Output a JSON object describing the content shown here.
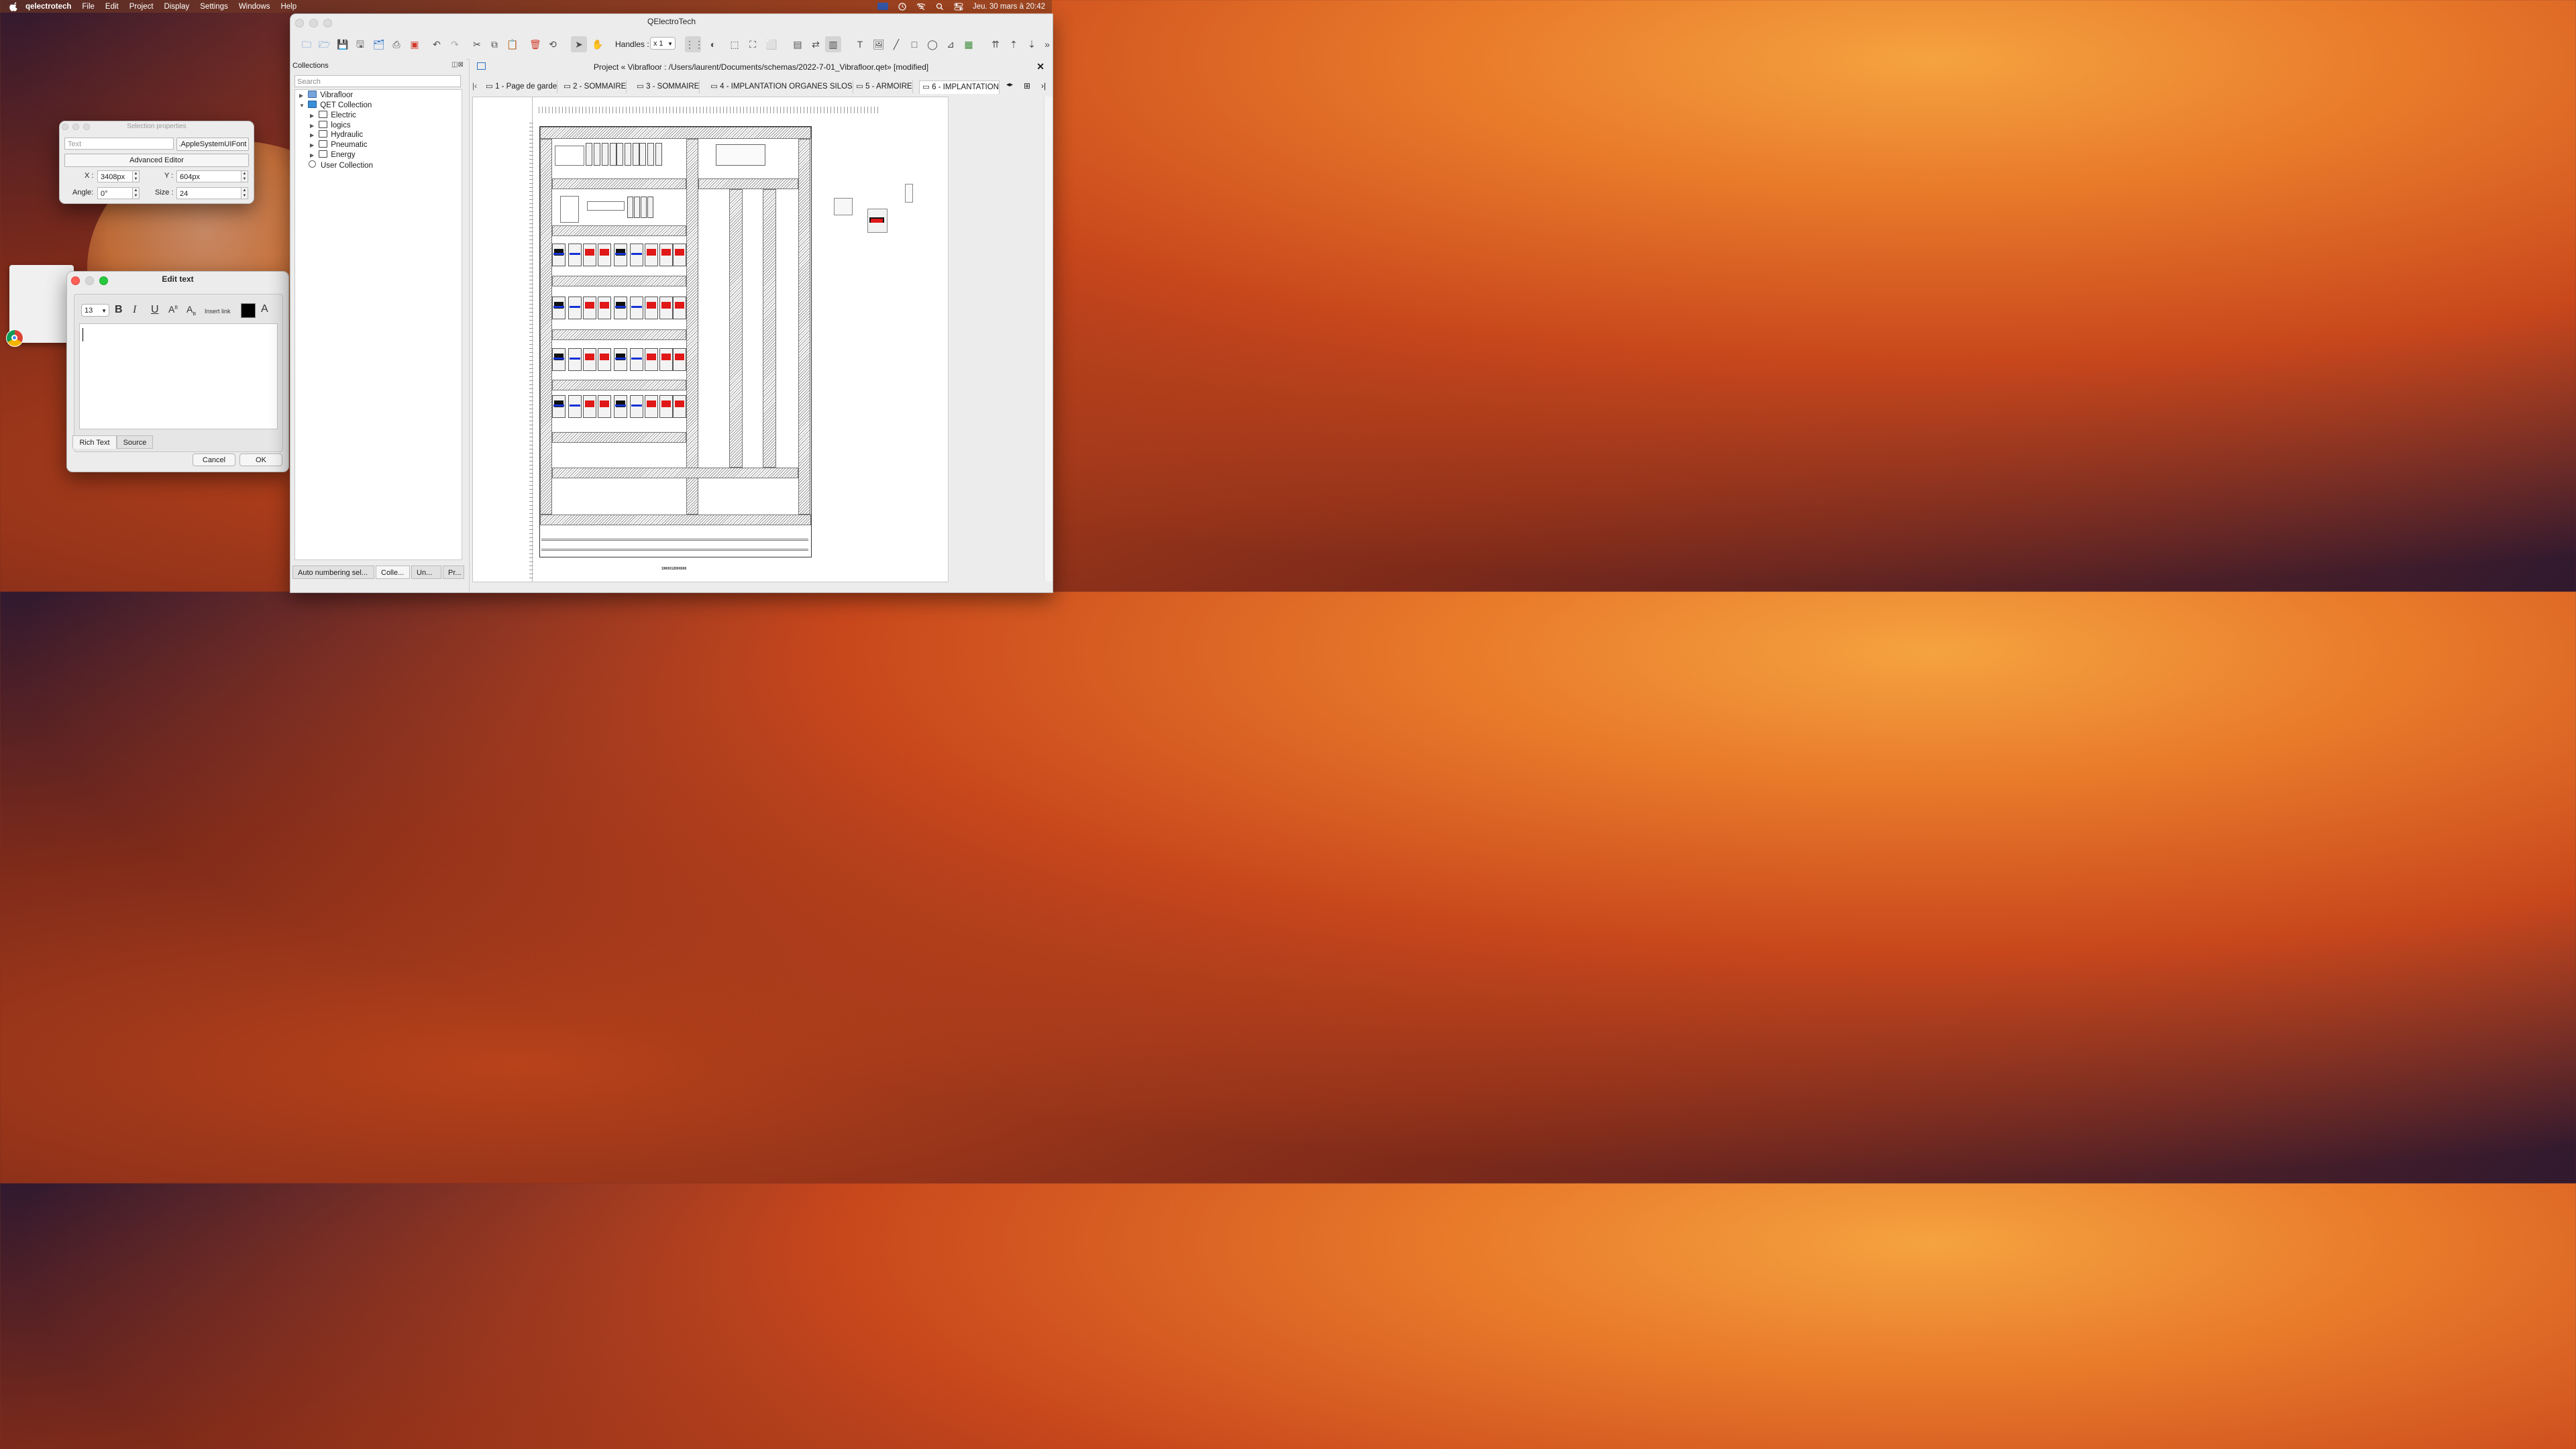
{
  "menubar": {
    "app_name": "qelectrotech",
    "items": [
      "File",
      "Edit",
      "Project",
      "Display",
      "Settings",
      "Windows",
      "Help"
    ],
    "clock": "Jeu. 30 mars à 20:42"
  },
  "selection_props": {
    "title": "Selection properties",
    "text_placeholder": "Text",
    "font_button": ".AppleSystemUIFont",
    "advanced_editor": "Advanced Editor",
    "x_label": "X :",
    "x_value": "3408px",
    "y_label": "Y :",
    "y_value": "604px",
    "angle_label": "Angle:",
    "angle_value": "0°",
    "size_label": "Size :",
    "size_value": "24"
  },
  "edit_text": {
    "title": "Edit text",
    "font_size": "13",
    "bold": "B",
    "italic": "I",
    "underline": "U",
    "insert_link": "Insert link",
    "tab_rich": "Rich Text",
    "tab_source": "Source",
    "cancel": "Cancel",
    "ok": "OK"
  },
  "main": {
    "window_title": "QElectroTech",
    "handles_label": "Handles :",
    "handles_value": "x 1",
    "collections_title": "Collections",
    "search_placeholder": "Search",
    "tree": [
      {
        "label": "Vibrafloor",
        "level": 0,
        "arrow": "▶",
        "icon": "folder-blue"
      },
      {
        "label": "QET Collection",
        "level": 0,
        "arrow": "▼",
        "icon": "qet"
      },
      {
        "label": "Electric",
        "level": 1,
        "arrow": "▶",
        "icon": "folder"
      },
      {
        "label": "logics",
        "level": 1,
        "arrow": "▶",
        "icon": "folder"
      },
      {
        "label": "Hydraulic",
        "level": 1,
        "arrow": "▶",
        "icon": "folder"
      },
      {
        "label": "Pneumatic",
        "level": 1,
        "arrow": "▶",
        "icon": "folder"
      },
      {
        "label": "Energy",
        "level": 1,
        "arrow": "▶",
        "icon": "folder"
      },
      {
        "label": "User Collection",
        "level": 0,
        "arrow": "",
        "icon": "user"
      }
    ],
    "bottom_tabs": [
      "Auto numbering sel...",
      "Colle...",
      "Un...",
      "Pr..."
    ],
    "project_title": "Project « Vibrafloor : /Users/laurent/Documents/schemas/2022-7-01_Vibrafloor.qet» [modified]",
    "page_tabs": [
      "1 - Page de garde",
      "2 - SOMMAIRE",
      "3 - SOMMAIRE",
      "4 - IMPLANTATION ORGANES SILOS",
      "5 - ARMOIRE",
      "6 - IMPLANTATION"
    ],
    "drawing_caption": "1900X1200X600"
  },
  "colors": {
    "accent_red": "#e01818",
    "accent_blue": "#1532d6",
    "mac_red": "#fe5f57",
    "mac_yellow": "#febc2e",
    "mac_green": "#28c840"
  }
}
